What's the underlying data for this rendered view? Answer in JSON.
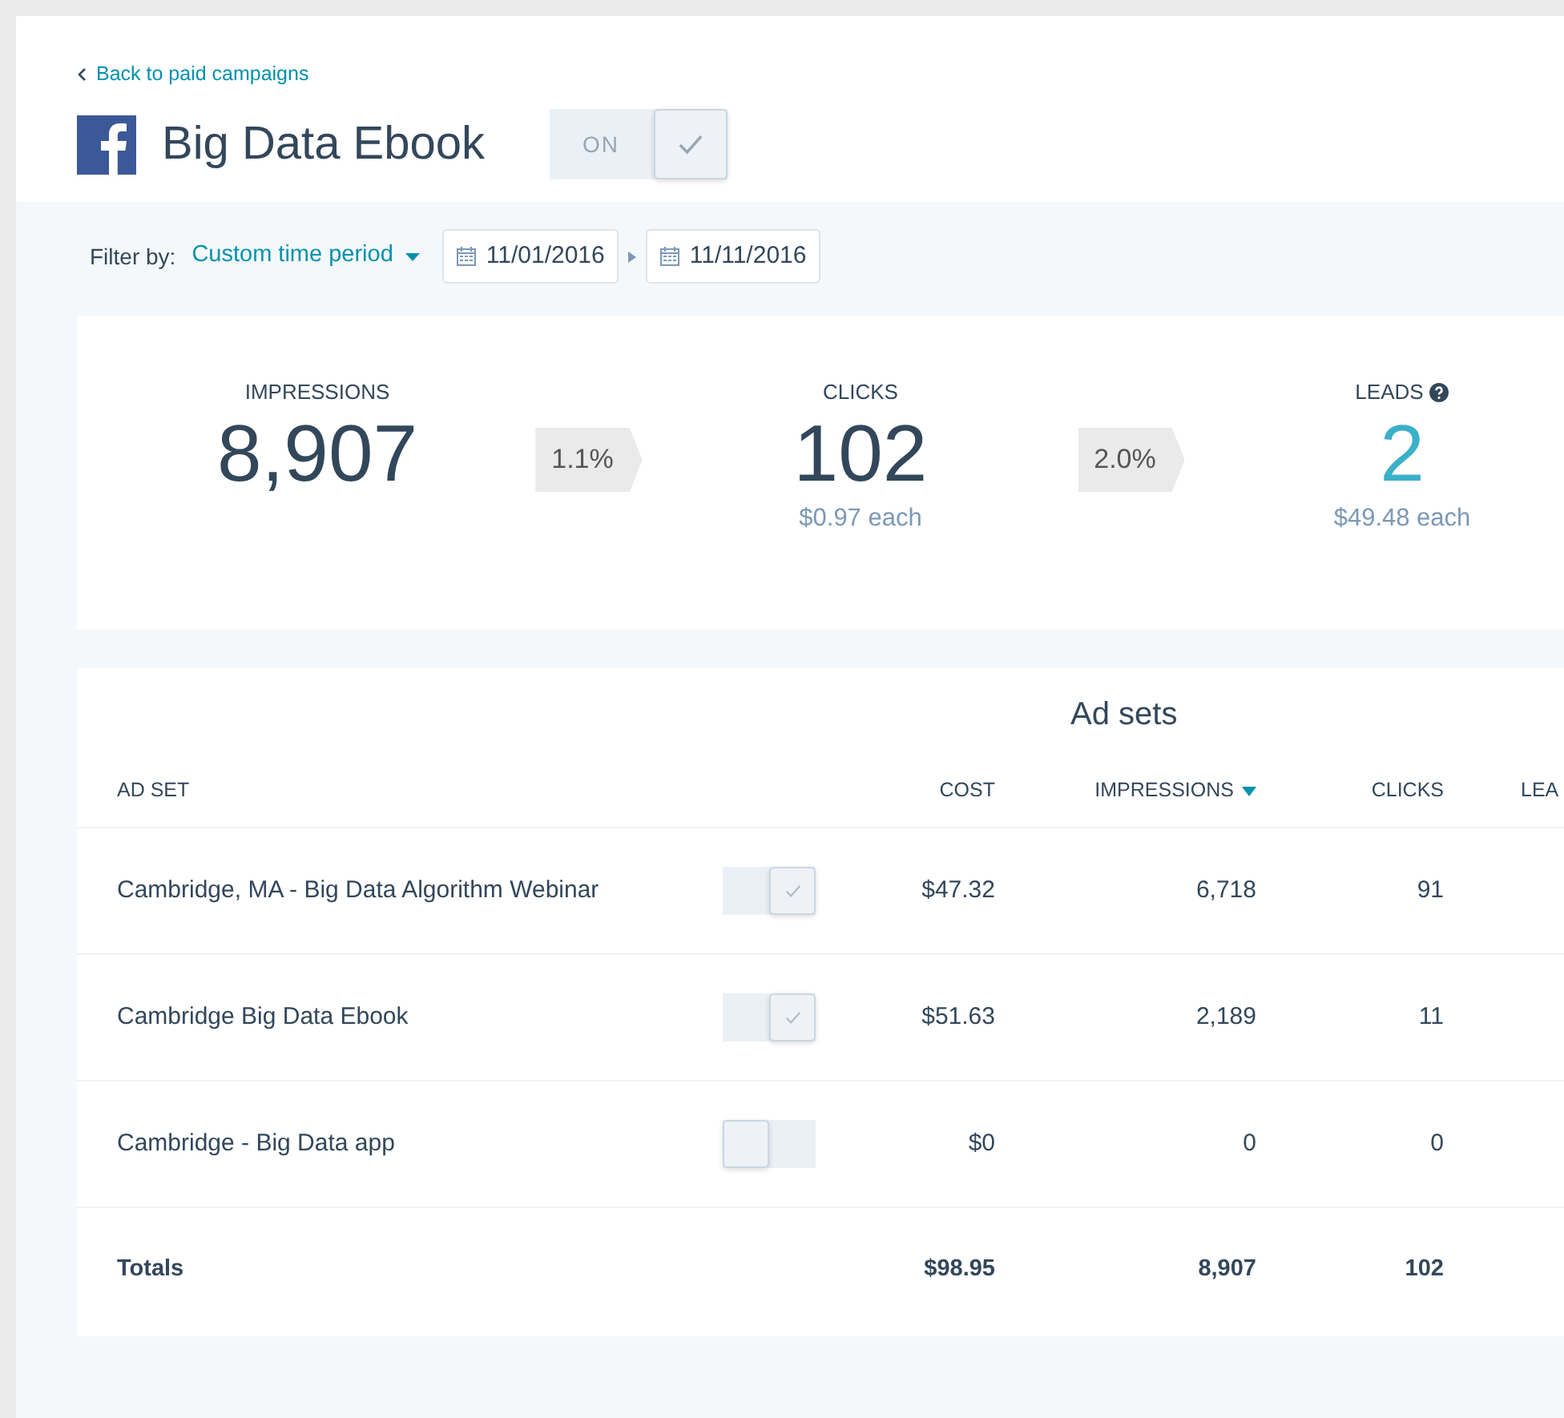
{
  "back_link": {
    "label": "Back to paid campaigns"
  },
  "campaign": {
    "title": "Big Data Ebook",
    "toggle": {
      "label": "ON",
      "on": true
    }
  },
  "filter": {
    "label": "Filter by:",
    "period": "Custom time period",
    "start_date": "11/01/2016",
    "end_date": "11/11/2016"
  },
  "funnel": [
    {
      "kind": "stat",
      "label": "IMPRESSIONS",
      "value": "8,907"
    },
    {
      "kind": "rate",
      "value": "1.1%"
    },
    {
      "kind": "stat",
      "label": "CLICKS",
      "value": "102",
      "sub": "$0.97 each"
    },
    {
      "kind": "rate",
      "value": "2.0%"
    },
    {
      "kind": "stat",
      "label": "LEADS",
      "value": "2",
      "sub": "$49.48 each",
      "help": true,
      "highlight": true
    }
  ],
  "ad_sets": {
    "title": "Ad sets",
    "columns": [
      {
        "label": "AD SET",
        "sorted": false
      },
      {
        "label": "COST",
        "sorted": false
      },
      {
        "label": "IMPRESSIONS",
        "sorted": true
      },
      {
        "label": "CLICKS",
        "sorted": false
      },
      {
        "label": "LEA",
        "sorted": false
      }
    ],
    "rows": [
      {
        "name": "Cambridge, MA - Big Data Algorithm Webinar",
        "on": true,
        "cost": "$47.32",
        "impressions": "6,718",
        "clicks": "91"
      },
      {
        "name": "Cambridge Big Data Ebook",
        "on": true,
        "cost": "$51.63",
        "impressions": "2,189",
        "clicks": "11"
      },
      {
        "name": "Cambridge - Big Data app",
        "on": false,
        "cost": "$0",
        "impressions": "0",
        "clicks": "0"
      }
    ],
    "totals": {
      "label": "Totals",
      "cost": "$98.95",
      "impressions": "8,907",
      "clicks": "102"
    }
  }
}
